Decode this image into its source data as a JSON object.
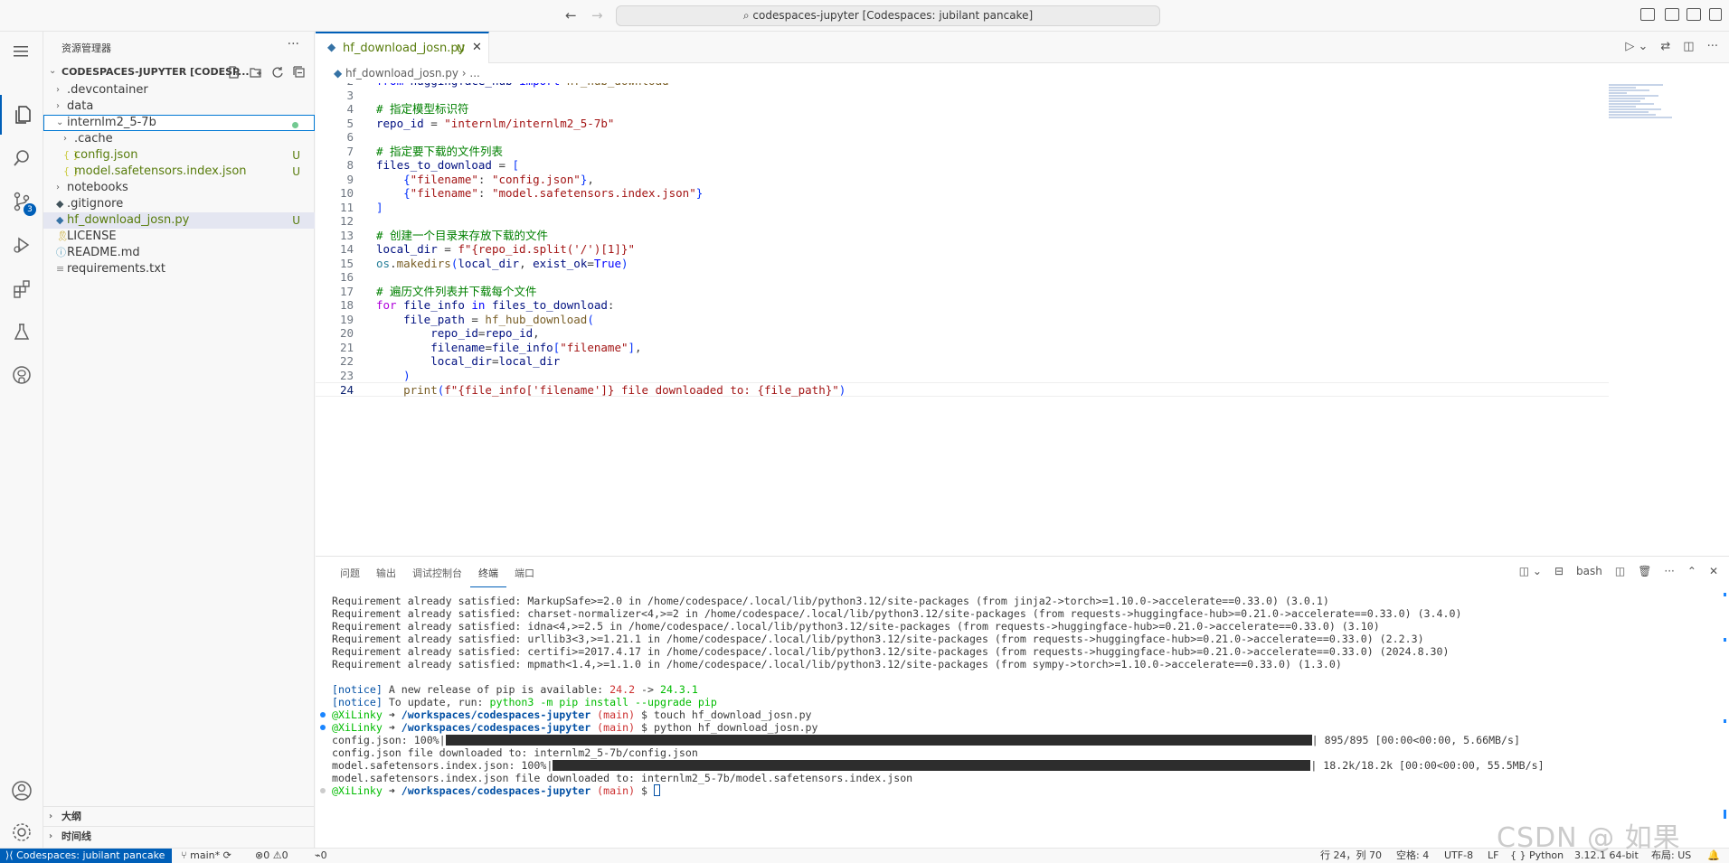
{
  "titlebar": {
    "command_center": "codespaces-jupyter [Codespaces: jubilant pancake]",
    "back_glyph": "←",
    "forward_glyph": "→"
  },
  "activity_bar": {
    "items": [
      "explorer-icon",
      "search-icon",
      "source-control-icon",
      "run-debug-icon",
      "extensions-icon",
      "testing-icon",
      "github-icon"
    ],
    "source_control_badge": "3",
    "bottom": [
      "account-icon",
      "manage-gear-icon"
    ]
  },
  "sidebar": {
    "title": "资源管理器",
    "more": "···",
    "section_title": "CODESPACES-JUPYTER [CODESP...",
    "tree": [
      {
        "label": ".devcontainer",
        "type": "folder",
        "expanded": false,
        "depth": 0
      },
      {
        "label": "data",
        "type": "folder",
        "expanded": false,
        "depth": 0
      },
      {
        "label": "internlm2_5-7b",
        "type": "folder",
        "expanded": true,
        "depth": 0,
        "decoration": "dot"
      },
      {
        "label": ".cache",
        "type": "folder",
        "expanded": false,
        "depth": 1
      },
      {
        "label": "config.json",
        "type": "json",
        "depth": 1,
        "git": "U"
      },
      {
        "label": "model.safetensors.index.json",
        "type": "json",
        "depth": 1,
        "git": "U"
      },
      {
        "label": "notebooks",
        "type": "folder",
        "expanded": false,
        "depth": 0
      },
      {
        "label": ".gitignore",
        "type": "git",
        "depth": 0
      },
      {
        "label": "hf_download_josn.py",
        "type": "python",
        "depth": 0,
        "git": "U"
      },
      {
        "label": "LICENSE",
        "type": "license",
        "depth": 0
      },
      {
        "label": "README.md",
        "type": "info",
        "depth": 0
      },
      {
        "label": "requirements.txt",
        "type": "text",
        "depth": 0
      }
    ],
    "outline_label": "大纲",
    "timeline_label": "时间线"
  },
  "editor": {
    "tab_label": "hf_download_josn.py",
    "tab_status": "U",
    "breadcrumb": "hf_download_josn.py",
    "breadcrumb_more": "...",
    "current_line": 24,
    "lines": [
      {
        "n": 2,
        "text": "from huggingface_hub import hf_hub_download"
      },
      {
        "n": 3,
        "text": ""
      },
      {
        "n": 4,
        "text": "# 指定模型标识符"
      },
      {
        "n": 5,
        "text": "repo_id = \"internlm/internlm2_5-7b\""
      },
      {
        "n": 6,
        "text": ""
      },
      {
        "n": 7,
        "text": "# 指定要下载的文件列表"
      },
      {
        "n": 8,
        "text": "files_to_download = ["
      },
      {
        "n": 9,
        "text": "    {\"filename\": \"config.json\"},"
      },
      {
        "n": 10,
        "text": "    {\"filename\": \"model.safetensors.index.json\"}"
      },
      {
        "n": 11,
        "text": "]"
      },
      {
        "n": 12,
        "text": ""
      },
      {
        "n": 13,
        "text": "# 创建一个目录来存放下载的文件"
      },
      {
        "n": 14,
        "text": "local_dir = f\"{repo_id.split('/')[1]}\""
      },
      {
        "n": 15,
        "text": "os.makedirs(local_dir, exist_ok=True)"
      },
      {
        "n": 16,
        "text": ""
      },
      {
        "n": 17,
        "text": "# 遍历文件列表并下载每个文件"
      },
      {
        "n": 18,
        "text": "for file_info in files_to_download:"
      },
      {
        "n": 19,
        "text": "    file_path = hf_hub_download("
      },
      {
        "n": 20,
        "text": "        repo_id=repo_id,"
      },
      {
        "n": 21,
        "text": "        filename=file_info[\"filename\"],"
      },
      {
        "n": 22,
        "text": "        local_dir=local_dir"
      },
      {
        "n": 23,
        "text": "    )"
      },
      {
        "n": 24,
        "text": "    print(f\"{file_info['filename']} file downloaded to: {file_path}\")"
      }
    ]
  },
  "panel": {
    "tabs": [
      "问题",
      "输出",
      "调试控制台",
      "终端",
      "端口"
    ],
    "active_tab": "终端",
    "shell": "bash",
    "terminal_lines": [
      "Requirement already satisfied: MarkupSafe>=2.0 in /home/codespace/.local/lib/python3.12/site-packages (from jinja2->torch>=1.10.0->accelerate==0.33.0) (3.0.1)",
      "Requirement already satisfied: charset-normalizer<4,>=2 in /home/codespace/.local/lib/python3.12/site-packages (from requests->huggingface-hub>=0.21.0->accelerate==0.33.0) (3.4.0)",
      "Requirement already satisfied: idna<4,>=2.5 in /home/codespace/.local/lib/python3.12/site-packages (from requests->huggingface-hub>=0.21.0->accelerate==0.33.0) (3.10)",
      "Requirement already satisfied: urllib3<3,>=1.21.1 in /home/codespace/.local/lib/python3.12/site-packages (from requests->huggingface-hub>=0.21.0->accelerate==0.33.0) (2.2.3)",
      "Requirement already satisfied: certifi>=2017.4.17 in /home/codespace/.local/lib/python3.12/site-packages (from requests->huggingface-hub>=0.21.0->accelerate==0.33.0) (2024.8.30)",
      "Requirement already satisfied: mpmath<1.4,>=1.1.0 in /home/codespace/.local/lib/python3.12/site-packages (from sympy->torch>=1.10.0->accelerate==0.33.0) (1.3.0)",
      ""
    ],
    "notice1": {
      "tag": "[notice]",
      "text": " A new release of pip is available: ",
      "old": "24.2",
      "arrow": " -> ",
      "new": "24.3.1"
    },
    "notice2": {
      "tag": "[notice]",
      "text": " To update, run: ",
      "cmd": "python3 -m pip install --upgrade pip"
    },
    "prompt_user": "@XiLinky",
    "prompt_arrow": " ➜ ",
    "prompt_path": "/workspaces/codespaces-jupyter",
    "prompt_branch": " (main)",
    "prompt_dollar": " $ ",
    "cmd1": "touch hf_download_josn.py",
    "cmd2": "python hf_download_josn.py",
    "dl1_label": "config.json: 100%|",
    "dl1_stats": "| 895/895 [00:00<00:00, 5.66MB/s]",
    "dl1_done": "config.json file downloaded to: internlm2_5-7b/config.json",
    "dl2_label": "model.safetensors.index.json: 100%|",
    "dl2_stats": "| 18.2k/18.2k [00:00<00:00, 55.5MB/s]",
    "dl2_done": "model.safetensors.index.json file downloaded to: internlm2_5-7b/model.safetensors.index.json",
    "progress": [
      1.0,
      1.0
    ]
  },
  "statusbar": {
    "remote": "Codespaces: jubilant pancake",
    "branch": "main*",
    "errors": "0",
    "warnings": "0",
    "ports": "0",
    "position": "行 24，列 70",
    "spaces": "空格: 4",
    "encoding": "UTF-8",
    "eol": "LF",
    "language": "Python",
    "interpreter": "3.12.1 64-bit",
    "layout": "布局: US"
  },
  "watermark": "CSDN @ 如果",
  "colors": {
    "accent": "#005fb8",
    "untracked": "#587c0c",
    "comment": "#008000",
    "string": "#a31515",
    "keyword": "#0000ff"
  }
}
